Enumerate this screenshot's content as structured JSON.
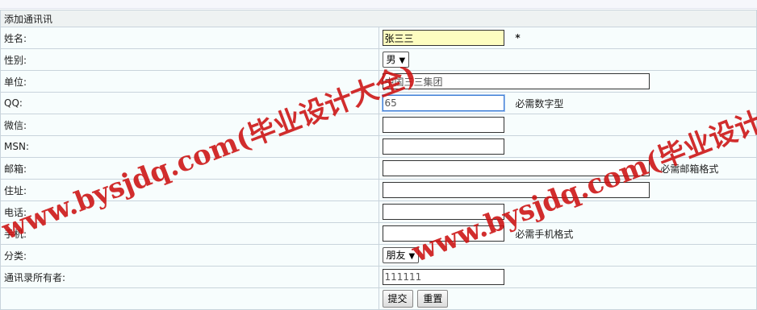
{
  "form": {
    "title": "添加通讯讯",
    "fields": {
      "name": {
        "label": "姓名:",
        "value": "张三三",
        "required_mark": "*"
      },
      "gender": {
        "label": "性别:",
        "selected": "男"
      },
      "company": {
        "label": "单位:",
        "value": "中国三三集团"
      },
      "qq": {
        "label": "QQ:",
        "value": "65",
        "hint": "必需数字型"
      },
      "wechat": {
        "label": "微信:",
        "value": ""
      },
      "msn": {
        "label": "MSN:",
        "value": ""
      },
      "email": {
        "label": "邮箱:",
        "value": "",
        "hint": "必需邮箱格式"
      },
      "address": {
        "label": "住址:",
        "value": ""
      },
      "phone": {
        "label": "电话:",
        "value": ""
      },
      "mobile": {
        "label": "手机:",
        "value": "",
        "hint": "必需手机格式"
      },
      "category": {
        "label": "分类:",
        "selected": "朋友"
      },
      "owner": {
        "label": "通讯录所有者:",
        "value": "111111"
      }
    },
    "buttons": {
      "submit": "提交",
      "reset": "重置"
    }
  },
  "watermark": {
    "text": "www.bysjdq.com(毕业设计大全)",
    "color": "#cc1111"
  }
}
